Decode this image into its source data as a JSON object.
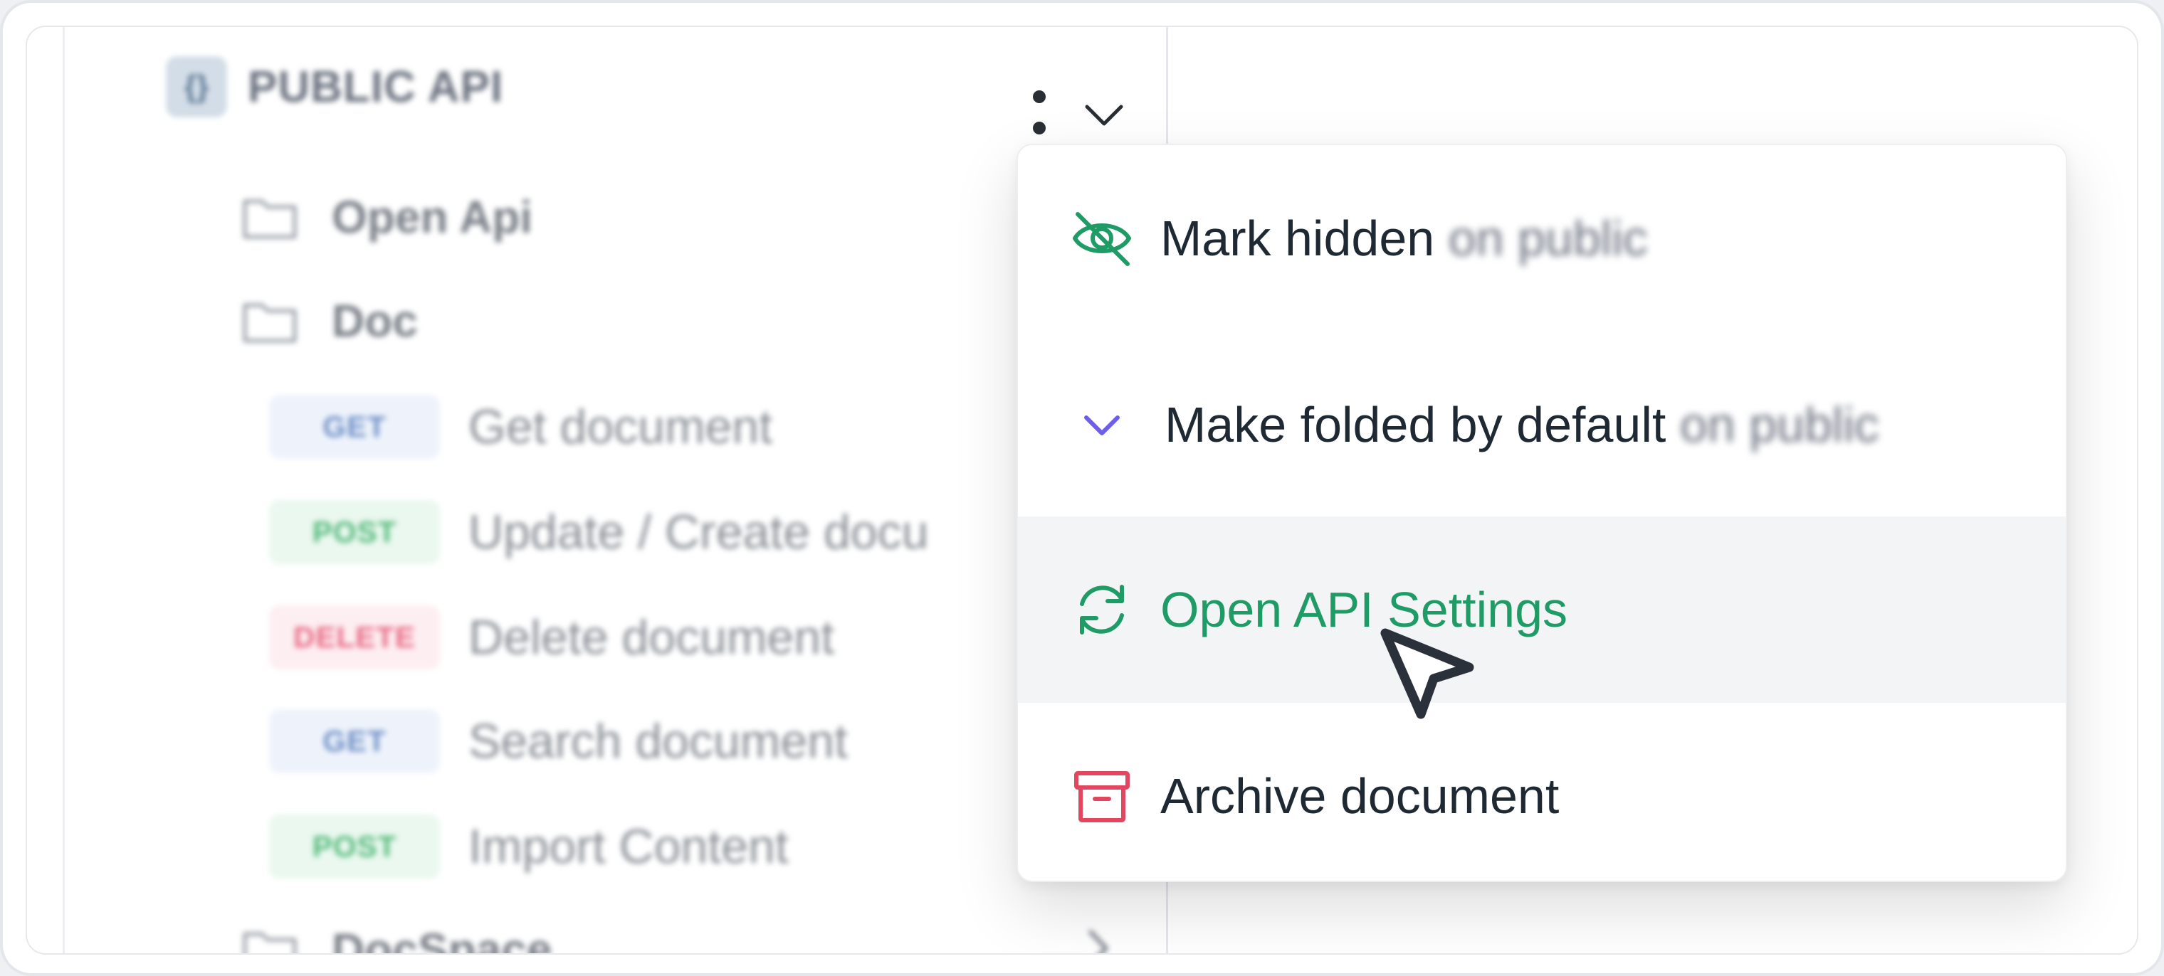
{
  "sidebar": {
    "project": {
      "icon_letter": "{}",
      "title": "PUBLIC API"
    },
    "folders": [
      {
        "label": "Open Api"
      },
      {
        "label": "Doc"
      },
      {
        "label": "DocSpace"
      }
    ],
    "endpoints": [
      {
        "method": "GET",
        "label": "Get document"
      },
      {
        "method": "POST",
        "label": "Update / Create docu"
      },
      {
        "method": "DELETE",
        "label": "Delete document"
      },
      {
        "method": "GET",
        "label": "Search document"
      },
      {
        "method": "POST",
        "label": "Import Content"
      }
    ]
  },
  "menu": {
    "items": [
      {
        "label": "Mark hidden",
        "suffix": " on public",
        "icon": "eye-off-icon"
      },
      {
        "label": "Make folded by default",
        "suffix": " on public",
        "icon": "chevron-down-icon"
      },
      {
        "label": "Open API Settings",
        "icon": "refresh-icon"
      },
      {
        "label": "Archive document",
        "icon": "archive-icon"
      }
    ]
  },
  "colors": {
    "green": "#1f9b65",
    "purple": "#6d5ef0",
    "red": "#e2475f",
    "get": "#6d8fc6",
    "post": "#54b97b",
    "delete": "#e86a85"
  }
}
